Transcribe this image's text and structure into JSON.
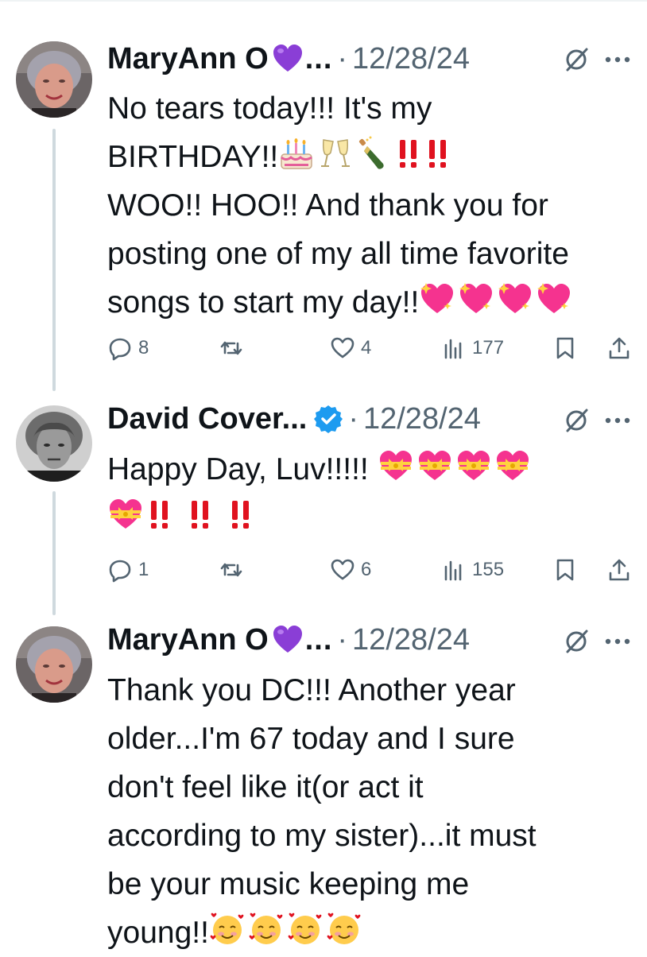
{
  "colors": {
    "text": "#0f1419",
    "muted": "#536471",
    "thread_line": "#cfd9de",
    "verified_blue": "#1d9bf0",
    "purple_heart": "#8a3ed6",
    "red_exclaim": "#e0121f",
    "sparkle_heart": "#f5338f"
  },
  "tweets": [
    {
      "name": "MaryAnn O",
      "name_badge_icon": "purple-heart-emoji",
      "ellipsis": "...",
      "separator": "·",
      "date": "12/28/24",
      "lines": [
        "No tears today!!! It's my",
        "BIRTHDAY!!",
        "WOO!! HOO!! And thank you for",
        "posting one of my all time favorite",
        "songs to start my day!!"
      ],
      "replies": "8",
      "likes": "4",
      "views": "177"
    },
    {
      "name": "David Cover...",
      "name_badge_icon": "verified-badge",
      "separator": "·",
      "date": "12/28/24",
      "lines": [
        "Happy Day, Luv!!!!!"
      ],
      "replies": "1",
      "likes": "6",
      "views": "155"
    },
    {
      "name": "MaryAnn O",
      "name_badge_icon": "purple-heart-emoji",
      "ellipsis": "...",
      "separator": "·",
      "date": "12/28/24",
      "lines": [
        "Thank you DC!!! Another year",
        "older...I'm 67 today and I sure",
        "don't feel like it(or act it",
        "according to my sister)...it must",
        "be your music keeping me",
        "young!!"
      ]
    }
  ]
}
